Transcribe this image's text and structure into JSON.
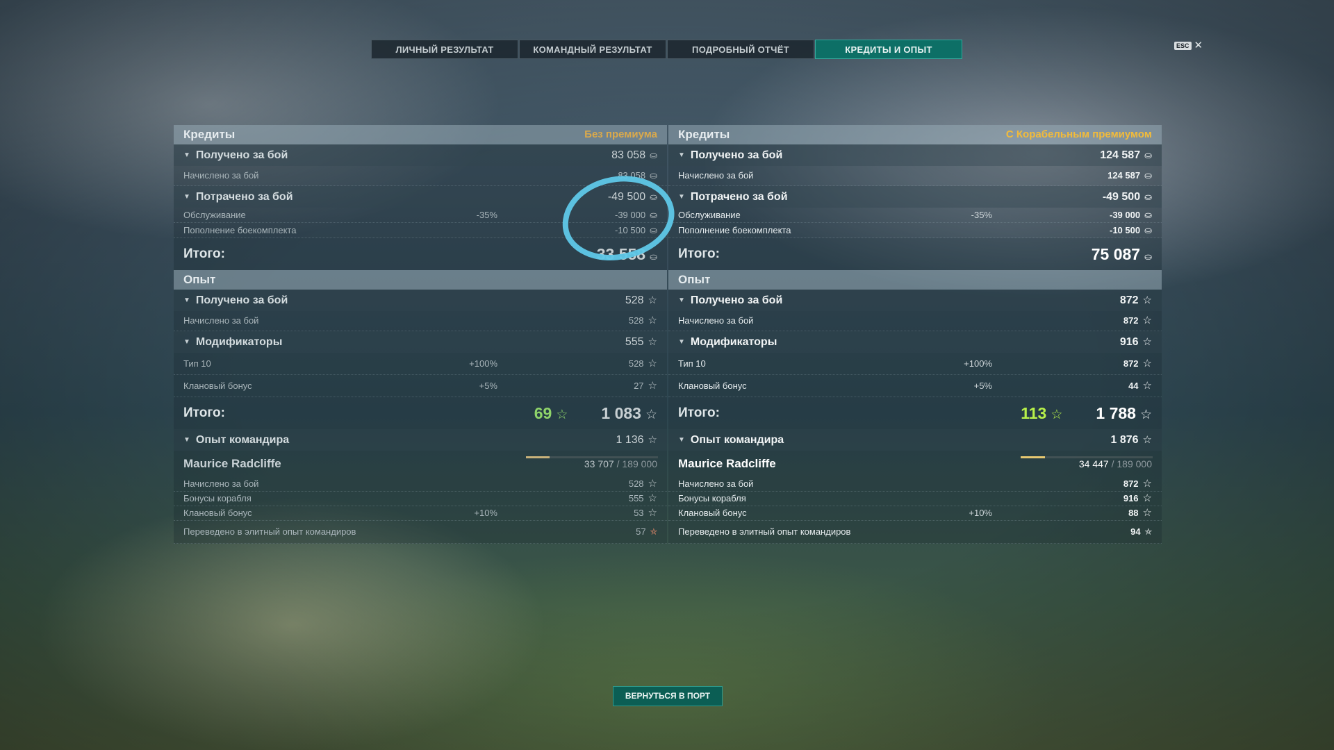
{
  "tabs": [
    {
      "label": "ЛИЧНЫЙ РЕЗУЛЬТАТ"
    },
    {
      "label": "КОМАНДНЫЙ РЕЗУЛЬТАТ"
    },
    {
      "label": "ПОДРОБНЫЙ ОТЧЁТ"
    },
    {
      "label": "КРЕДИТЫ И ОПЫТ"
    }
  ],
  "esc_label": "ESC",
  "close_glyph": "✕",
  "coin_glyph": "⛀",
  "star_glyph": "☆",
  "elite_glyph": "⛤",
  "arrow_glyph": "▼",
  "left": {
    "credits_title": "Кредиты",
    "credits_note": "Без премиума",
    "earned_label": "Получено за бой",
    "earned_value": "83 058",
    "earned_sub_label": "Начислено за бой",
    "earned_sub_value": "83 058",
    "spent_label": "Потрачено за бой",
    "spent_value": "-49 500",
    "service_label": "Обслуживание",
    "service_pct": "-35%",
    "service_value": "-39 000",
    "ammo_label": "Пополнение боекомплекта",
    "ammo_value": "-10 500",
    "total_label": "Итого:",
    "total_value": "33 558",
    "xp_title": "Опыт",
    "xp_earned_label": "Получено за бой",
    "xp_earned_value": "528",
    "xp_earned_sub_label": "Начислено за бой",
    "xp_earned_sub_value": "528",
    "mods_label": "Модификаторы",
    "mods_value": "555",
    "tier_label": "Тип 10",
    "tier_pct": "+100%",
    "tier_value": "528",
    "clan_label": "Клановый бонус",
    "clan_pct": "+5%",
    "clan_value": "27",
    "xp_total_label": "Итого:",
    "xp_total_green": "69",
    "xp_total_value": "1 083",
    "cmd_xp_label": "Опыт командира",
    "cmd_xp_value": "1 136",
    "cmd_name": "Maurice Radcliffe",
    "cmd_progress": "33 707",
    "cmd_max": "189 000",
    "cmd_fill": 0.178,
    "cmd_earned_label": "Начислено за бой",
    "cmd_earned_value": "528",
    "cmd_ship_label": "Бонусы корабля",
    "cmd_ship_value": "555",
    "cmd_clan_label": "Клановый бонус",
    "cmd_clan_pct": "+10%",
    "cmd_clan_value": "53",
    "elite_label": "Переведено в элитный опыт командиров",
    "elite_value": "57"
  },
  "right": {
    "credits_title": "Кредиты",
    "credits_note": "С Корабельным премиумом",
    "earned_label": "Получено за бой",
    "earned_value": "124 587",
    "earned_sub_label": "Начислено за бой",
    "earned_sub_value": "124 587",
    "spent_label": "Потрачено за бой",
    "spent_value": "-49 500",
    "service_label": "Обслуживание",
    "service_pct": "-35%",
    "service_value": "-39 000",
    "ammo_label": "Пополнение боекомплекта",
    "ammo_value": "-10 500",
    "total_label": "Итого:",
    "total_value": "75 087",
    "xp_title": "Опыт",
    "xp_earned_label": "Получено за бой",
    "xp_earned_value": "872",
    "xp_earned_sub_label": "Начислено за бой",
    "xp_earned_sub_value": "872",
    "mods_label": "Модификаторы",
    "mods_value": "916",
    "tier_label": "Тип 10",
    "tier_pct": "+100%",
    "tier_value": "872",
    "clan_label": "Клановый бонус",
    "clan_pct": "+5%",
    "clan_value": "44",
    "xp_total_label": "Итого:",
    "xp_total_green": "113",
    "xp_total_value": "1 788",
    "cmd_xp_label": "Опыт командира",
    "cmd_xp_value": "1 876",
    "cmd_name": "Maurice Radcliffe",
    "cmd_progress": "34 447",
    "cmd_max": "189 000",
    "cmd_fill": 0.182,
    "cmd_earned_label": "Начислено за бой",
    "cmd_earned_value": "872",
    "cmd_ship_label": "Бонусы корабля",
    "cmd_ship_value": "916",
    "cmd_clan_label": "Клановый бонус",
    "cmd_clan_pct": "+10%",
    "cmd_clan_value": "88",
    "elite_label": "Переведено в элитный опыт командиров",
    "elite_value": "94"
  },
  "back_button": "ВЕРНУТЬСЯ В ПОРТ",
  "colors": {
    "accent": "#0d6f66",
    "premium_note": "#f2bb3a",
    "annotation": "#5fc8e8"
  }
}
